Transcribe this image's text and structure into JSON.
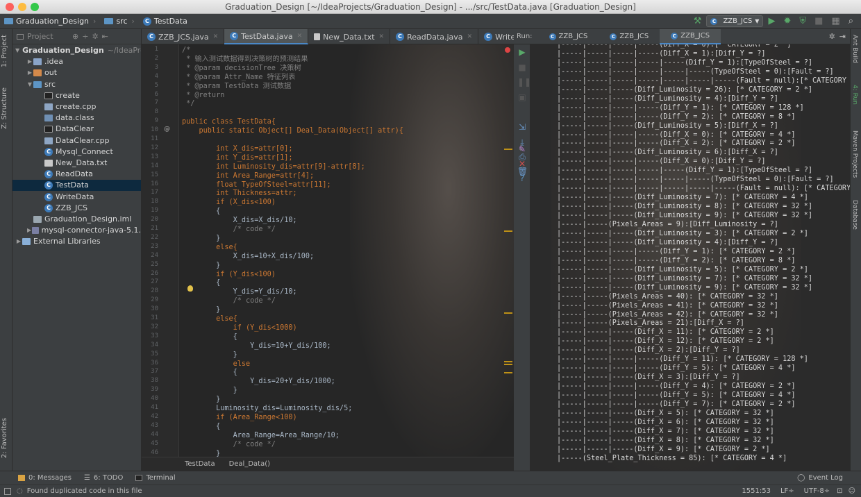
{
  "window": {
    "title": "Graduation_Design [~/IdeaProjects/Graduation_Design] - .../src/TestData.java [Graduation_Design]"
  },
  "navbar": {
    "project": "Graduation_Design",
    "folder": "src",
    "file": "TestData",
    "run_config": "ZZB_JCS"
  },
  "left_strip": {
    "project": "1: Project",
    "structure": "Z: Structure",
    "favorites": "2: Favorites"
  },
  "project_panel": {
    "header": "Project",
    "items": [
      {
        "label": "Graduation_Design",
        "extra": "~/IdeaPro",
        "depth": 0,
        "icon": "folder-icon",
        "expanded": true
      },
      {
        "label": ".idea",
        "depth": 1,
        "icon": "folder-icon",
        "expanded": false
      },
      {
        "label": "out",
        "depth": 1,
        "icon": "out-folder-icon",
        "expanded": false
      },
      {
        "label": "src",
        "depth": 1,
        "icon": "source-folder-icon",
        "expanded": true
      },
      {
        "label": "create",
        "depth": 2,
        "icon": "executable-icon"
      },
      {
        "label": "create.cpp",
        "depth": 2,
        "icon": "cpp-file-icon"
      },
      {
        "label": "data.class",
        "depth": 2,
        "icon": "class-file-icon"
      },
      {
        "label": "DataClear",
        "depth": 2,
        "icon": "executable-icon"
      },
      {
        "label": "DataClear.cpp",
        "depth": 2,
        "icon": "cpp-file-icon"
      },
      {
        "label": "Mysql_Connect",
        "depth": 2,
        "icon": "java-class-icon"
      },
      {
        "label": "New_Data.txt",
        "depth": 2,
        "icon": "text-file-icon"
      },
      {
        "label": "ReadData",
        "depth": 2,
        "icon": "java-class-icon"
      },
      {
        "label": "TestData",
        "depth": 2,
        "icon": "java-class-icon",
        "selected": true
      },
      {
        "label": "WriteData",
        "depth": 2,
        "icon": "java-class-icon"
      },
      {
        "label": "ZZB_JCS",
        "depth": 2,
        "icon": "java-class-icon"
      },
      {
        "label": "Graduation_Design.iml",
        "depth": 1,
        "icon": "iml-file-icon"
      },
      {
        "label": "mysql-connector-java-5.1.",
        "depth": 1,
        "icon": "jar-icon",
        "expanded": false
      },
      {
        "label": "External Libraries",
        "depth": 0,
        "icon": "library-icon",
        "expanded": false
      }
    ]
  },
  "editor_tabs": [
    {
      "label": "ZZB_JCS.java",
      "icon": "java-class-icon"
    },
    {
      "label": "TestData.java",
      "icon": "java-class-icon",
      "active": true
    },
    {
      "label": "New_Data.txt",
      "icon": "text-file-icon"
    },
    {
      "label": "ReadData.java",
      "icon": "java-class-icon"
    },
    {
      "label": "WriteData.java",
      "icon": "java-class-icon"
    }
  ],
  "editor": {
    "line_numbers": [
      "1",
      "2",
      "3",
      "4",
      "5",
      "6",
      "7",
      "8",
      "9",
      "10",
      "11",
      "12",
      "13",
      "14",
      "15",
      "16",
      "17",
      "18",
      "19",
      "20",
      "21",
      "22",
      "23",
      "24",
      "25",
      "26",
      "27",
      "28",
      "29",
      "30",
      "31",
      "32",
      "33",
      "34",
      "35",
      "36",
      "37",
      "38",
      "39",
      "40",
      "41",
      "42",
      "43",
      "44",
      "45",
      "46"
    ],
    "lines": [
      "/*",
      " * 输入测试数据得到决策树的预测结果",
      " * @param decisionTree 决策树",
      " * @param Attr_Name 特征列表",
      " * @param TestData 测试数据",
      " * @return",
      " */",
      "",
      "public class TestData{",
      "    public static Object[] Deal_Data(Object[] attr){",
      "",
      "        int X_dis=attr[0];",
      "        int Y_dis=attr[1];",
      "        int Luminosity_dis=attr[9]-attr[8];",
      "        int Area_Range=attr[4];",
      "        float TypeOfSteel=attr[11];",
      "        int Thickness=attr;",
      "        if (X_dis<100)",
      "        {",
      "            X_dis=X_dis/10;",
      "            /* code */",
      "        }",
      "        else{",
      "            X_dis=10+X_dis/100;",
      "        }",
      "        if (Y_dis<100)",
      "        {",
      "            Y_dis=Y_dis/10;",
      "            /* code */",
      "        }",
      "        else{",
      "            if (Y_dis<1000)",
      "            {",
      "                Y_dis=10+Y_dis/100;",
      "            }",
      "            else",
      "            {",
      "                Y_dis=20+Y_dis/1000;",
      "            }",
      "        }",
      "        Luminosity_dis=Luminosity_dis/5;",
      "        if (Area_Range<100)",
      "        {",
      "            Area_Range=Area_Range/10;",
      "            /* code */",
      "        }"
    ],
    "breadcrumb": [
      "TestData",
      "Deal_Data()"
    ]
  },
  "run_panel": {
    "label": "Run:",
    "tabs": [
      {
        "label": "ZZB_JCS"
      },
      {
        "label": "ZZB_JCS"
      },
      {
        "label": "ZZB_JCS",
        "active": true
      }
    ],
    "output": [
      "|-----|-----|-----|-----(Diff_X = 0):[* CATEGORY = 2 *]",
      "|-----|-----|-----|-----(Diff_X = 1):[Diff_Y = ?]",
      "|-----|-----|-----|-----|-----(Diff_Y = 1):[TypeOfSteel = ?]",
      "|-----|-----|-----|-----|-----|-----(TypeOfSteel = 0):[Fault = ?]",
      "|-----|-----|-----|-----|-----|-----|-----(Fault = null):[* CATEGORY",
      "|-----|-----|-----(Diff_Luminosity = 26): [* CATEGORY = 2 *]",
      "|-----|-----|-----(Diff_Luminosity = 4):[Diff_Y = ?]",
      "|-----|-----|-----|-----(Diff_Y = 1): [* CATEGORY = 128 *]",
      "|-----|-----|-----|-----(Diff_Y = 2): [* CATEGORY = 8 *]",
      "|-----|-----|-----(Diff_Luminosity = 5):[Diff_X = ?]",
      "|-----|-----|-----|-----(Diff_X = 0): [* CATEGORY = 4 *]",
      "|-----|-----|-----|-----(Diff_X = 2): [* CATEGORY = 2 *]",
      "|-----|-----|-----(Diff_Luminosity = 6):[Diff_X = ?]",
      "|-----|-----|-----|-----(Diff_X = 0):[Diff_Y = ?]",
      "|-----|-----|-----|-----|-----(Diff_Y = 1):[TypeOfSteel = ?]",
      "|-----|-----|-----|-----|-----|-----(TypeOfSteel = 0):[Fault = ?]",
      "|-----|-----|-----|-----|-----|-----|-----(Fault = null): [* CATEGORY",
      "|-----|-----|-----(Diff_Luminosity = 7): [* CATEGORY = 4 *]",
      "|-----|-----|-----(Diff_Luminosity = 8): [* CATEGORY = 32 *]",
      "|-----|-----|-----(Diff_Luminosity = 9): [* CATEGORY = 32 *]",
      "|-----|-----(Pixels_Areas = 9):[Diff_Luminosity = ?]",
      "|-----|-----|-----(Diff_Luminosity = 3): [* CATEGORY = 2 *]",
      "|-----|-----|-----(Diff_Luminosity = 4):[Diff_Y = ?]",
      "|-----|-----|-----|-----(Diff_Y = 1): [* CATEGORY = 2 *]",
      "|-----|-----|-----|-----(Diff_Y = 2): [* CATEGORY = 8 *]",
      "|-----|-----|-----(Diff_Luminosity = 5): [* CATEGORY = 2 *]",
      "|-----|-----|-----(Diff_Luminosity = 7): [* CATEGORY = 32 *]",
      "|-----|-----|-----(Diff_Luminosity = 9): [* CATEGORY = 32 *]",
      "|-----|-----(Pixels_Areas = 40): [* CATEGORY = 32 *]",
      "|-----|-----(Pixels_Areas = 41): [* CATEGORY = 32 *]",
      "|-----|-----(Pixels_Areas = 42): [* CATEGORY = 32 *]",
      "|-----|-----(Pixels_Areas = 21):[Diff_X = ?]",
      "|-----|-----|-----(Diff_X = 11): [* CATEGORY = 2 *]",
      "|-----|-----|-----(Diff_X = 12): [* CATEGORY = 2 *]",
      "|-----|-----|-----(Diff_X = 2):[Diff_Y = ?]",
      "|-----|-----|-----|-----(Diff_Y = 11): [* CATEGORY = 128 *]",
      "|-----|-----|-----|-----(Diff_Y = 5): [* CATEGORY = 4 *]",
      "|-----|-----|-----(Diff_X = 3):[Diff_Y = ?]",
      "|-----|-----|-----|-----(Diff_Y = 4): [* CATEGORY = 2 *]",
      "|-----|-----|-----|-----(Diff_Y = 5): [* CATEGORY = 4 *]",
      "|-----|-----|-----|-----(Diff_Y = 7): [* CATEGORY = 2 *]",
      "|-----|-----|-----(Diff_X = 5): [* CATEGORY = 32 *]",
      "|-----|-----|-----(Diff_X = 6): [* CATEGORY = 32 *]",
      "|-----|-----|-----(Diff_X = 7): [* CATEGORY = 32 *]",
      "|-----|-----|-----(Diff_X = 8): [* CATEGORY = 32 *]",
      "|-----|-----|-----(Diff_X = 9): [* CATEGORY = 2 *]",
      "|-----(Steel_Plate_Thickness = 85): [* CATEGORY = 4 *]"
    ]
  },
  "right_strip": {
    "ant": "Ant Build",
    "run": "4: Run",
    "maven": "Maven Projects",
    "database": "Database"
  },
  "bottom_tabs": [
    {
      "label": "0: Messages"
    },
    {
      "label": "6: TODO"
    },
    {
      "label": "Terminal"
    }
  ],
  "event_log": "Event Log",
  "status": {
    "message": "Found duplicated code in this file",
    "position": "1551:53",
    "line_sep": "LF÷",
    "encoding": "UTF-8÷"
  },
  "colors": {
    "accent": "#4a88c7",
    "keyword": "#cc7832",
    "comment": "#808080",
    "number": "#6897bb",
    "field": "#9876aa",
    "run_green": "#59a869"
  }
}
